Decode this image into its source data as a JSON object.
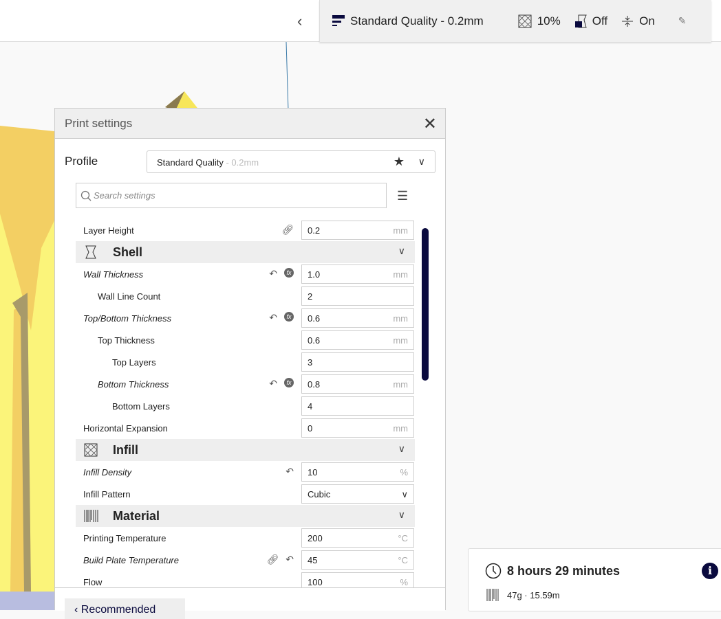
{
  "header": {
    "profile_summary": "Standard Quality - 0.2mm",
    "infill": "10%",
    "support": "Off",
    "adhesion": "On"
  },
  "panel": {
    "title": "Print settings",
    "profile_label": "Profile",
    "profile_name": "Standard Quality",
    "profile_sub": " - 0.2mm",
    "search_placeholder": "Search settings",
    "recommended_label": "Recommended"
  },
  "settings": {
    "layer_height": {
      "label": "Layer Height",
      "value": "0.2",
      "unit": "mm"
    },
    "shell": "Shell",
    "wall_thickness": {
      "label": "Wall Thickness",
      "value": "1.0",
      "unit": "mm"
    },
    "wall_line_count": {
      "label": "Wall Line Count",
      "value": "2"
    },
    "top_bottom_thickness": {
      "label": "Top/Bottom Thickness",
      "value": "0.6",
      "unit": "mm"
    },
    "top_thickness": {
      "label": "Top Thickness",
      "value": "0.6",
      "unit": "mm"
    },
    "top_layers": {
      "label": "Top Layers",
      "value": "3"
    },
    "bottom_thickness": {
      "label": "Bottom Thickness",
      "value": "0.8",
      "unit": "mm"
    },
    "bottom_layers": {
      "label": "Bottom Layers",
      "value": "4"
    },
    "horizontal_expansion": {
      "label": "Horizontal Expansion",
      "value": "0",
      "unit": "mm"
    },
    "infill": "Infill",
    "infill_density": {
      "label": "Infill Density",
      "value": "10",
      "unit": "%"
    },
    "infill_pattern": {
      "label": "Infill Pattern",
      "value": "Cubic"
    },
    "material": "Material",
    "printing_temperature": {
      "label": "Printing Temperature",
      "value": "200",
      "unit": "°C"
    },
    "build_plate_temperature": {
      "label": "Build Plate Temperature",
      "value": "45",
      "unit": "°C"
    },
    "flow": {
      "label": "Flow",
      "value": "100",
      "unit": "%"
    }
  },
  "estimate": {
    "time": "8 hours 29 minutes",
    "material": "47g · 15.59m"
  },
  "colors": {
    "accent": "#0a0a3e",
    "model": "#f7d75a"
  }
}
